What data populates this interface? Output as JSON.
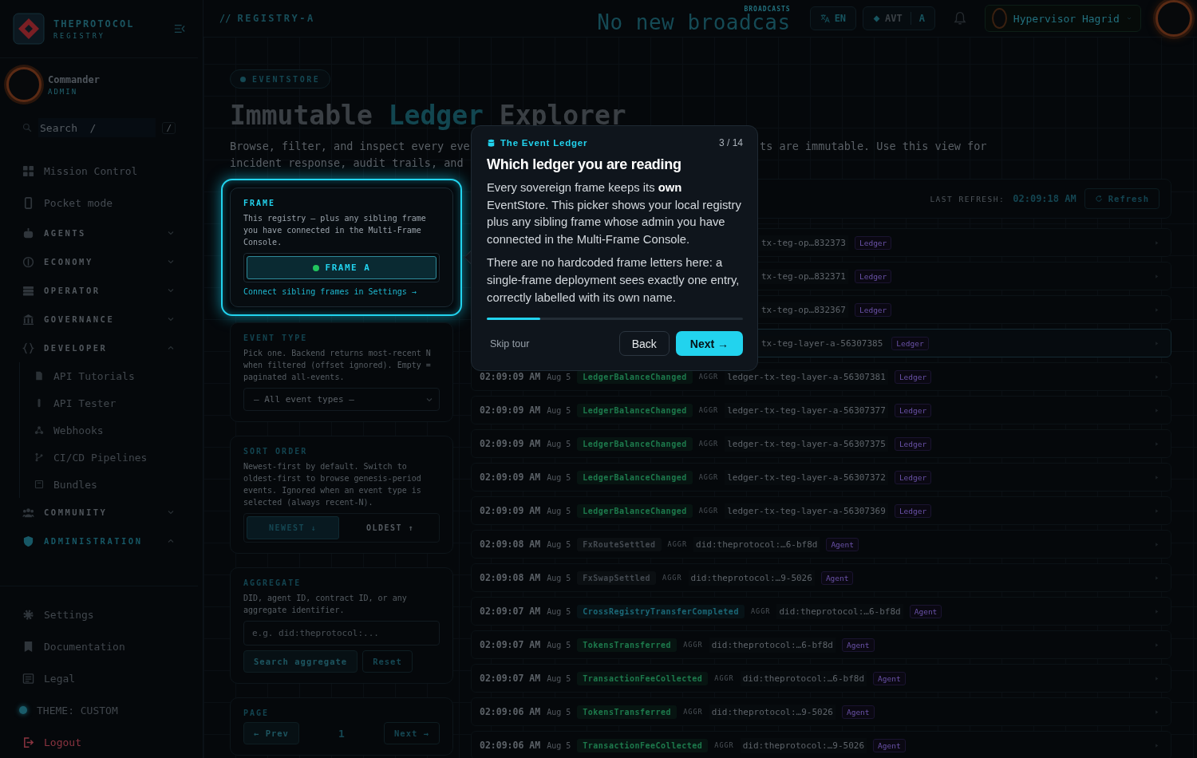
{
  "sidebar": {
    "brand": {
      "name": "THEPROTOCOL",
      "subtitle": "REGISTRY"
    },
    "user": {
      "name": "Commander",
      "role": "ADMIN"
    },
    "search": {
      "placeholder": "Search  /",
      "shortcut": "/"
    },
    "nav": [
      {
        "kind": "link",
        "label": "Mission Control",
        "selected": false
      },
      {
        "kind": "link",
        "label": "Pocket mode",
        "selected": false
      },
      {
        "kind": "section",
        "label": "AGENTS",
        "expanded": false,
        "selected": false
      },
      {
        "kind": "section",
        "label": "ECONOMY",
        "expanded": false,
        "selected": false
      },
      {
        "kind": "section",
        "label": "OPERATOR",
        "expanded": false,
        "selected": false
      },
      {
        "kind": "section",
        "label": "GOVERNANCE",
        "expanded": false,
        "selected": false
      },
      {
        "kind": "section",
        "label": "DEVELOPER",
        "expanded": true,
        "selected": false,
        "children": [
          {
            "label": "API Tutorials",
            "selected": false
          },
          {
            "label": "API Tester",
            "selected": false
          },
          {
            "label": "Webhooks",
            "selected": false
          },
          {
            "label": "CI/CD Pipelines",
            "selected": false
          },
          {
            "label": "Bundles",
            "selected": false
          }
        ]
      },
      {
        "kind": "section",
        "label": "COMMUNITY",
        "expanded": false,
        "selected": false
      },
      {
        "kind": "section",
        "label": "ADMINISTRATION",
        "expanded": true,
        "selected": true
      }
    ],
    "footer": [
      {
        "kind": "link",
        "label": "Settings"
      },
      {
        "kind": "link",
        "label": "Documentation"
      },
      {
        "kind": "link",
        "label": "Legal"
      },
      {
        "kind": "theme",
        "label": "THEME: CUSTOM"
      },
      {
        "kind": "danger",
        "label": "Logout"
      }
    ]
  },
  "topbar": {
    "separator": "//",
    "breadcrumb": "REGISTRY-A",
    "ticker_label": "BROADCASTS",
    "ticker": "No new broadcas",
    "language": "EN",
    "token": "AVT",
    "token_frame": "A",
    "user": "Hypervisor Hagrid"
  },
  "header": {
    "badge": "EVENTSTORE",
    "title_start": "Immutable",
    "title_highlight": "Ledger",
    "title_end": "Explorer",
    "description": [
      "Browse, filter, and inspect every eve",
      "ts are immutable. Use this view for",
      "incident response, audit trails, and"
    ]
  },
  "filters": {
    "frame": {
      "title": "FRAME",
      "description": "This registry — plus any sibling frame you have connected in the Multi-Frame Console.",
      "options": [
        {
          "label": "FRAME A",
          "selected": true
        }
      ],
      "link": "Connect sibling frames in Settings →"
    },
    "event_type": {
      "title": "EVENT TYPE",
      "description": "Pick one. Backend returns most-recent N when filtered (offset ignored). Empty = paginated all-events.",
      "value": "— All event types —"
    },
    "sort": {
      "title": "SORT ORDER",
      "description": "Newest-first by default. Switch to oldest-first to browse genesis-period events. Ignored when an event type is selected (always recent-N).",
      "options": [
        {
          "label": "NEWEST ↓",
          "selected": true
        },
        {
          "label": "OLDEST ↑",
          "selected": false
        }
      ]
    },
    "aggregate": {
      "title": "AGGREGATE",
      "description": "DID, agent ID, contract ID, or any aggregate identifier.",
      "placeholder": "e.g. did:theprotocol:...",
      "search": {
        "label": "Search aggregate",
        "disabled": true
      },
      "reset": "Reset"
    },
    "page": {
      "title": "PAGE",
      "prev": {
        "label": "← Prev",
        "disabled": true
      },
      "current": "1",
      "next": "Next →"
    }
  },
  "refresh": {
    "label": "LAST REFRESH:",
    "time": "02:09:18 AM",
    "button": "Refresh"
  },
  "events": [
    {
      "aggregate": "tx-teg-op…832373",
      "tag": "Ledger",
      "selected": false
    },
    {
      "aggregate": "tx-teg-op…832371",
      "tag": "Ledger",
      "selected": false
    },
    {
      "aggregate": "tx-teg-op…832367",
      "tag": "Ledger",
      "selected": false
    },
    {
      "aggregate": "tx-teg-layer-a-56307385",
      "tag": "Ledger",
      "selected": true
    },
    {
      "time": "02:09:09 AM",
      "date": "Aug 5",
      "type": "LedgerBalanceChanged",
      "color": "#1d7a4c",
      "aggr": "AGGR",
      "aggregate": "ledger-tx-teg-layer-a-56307381",
      "tag": "Ledger",
      "selected": false
    },
    {
      "time": "02:09:09 AM",
      "date": "Aug 5",
      "type": "LedgerBalanceChanged",
      "color": "#1d7a4c",
      "aggr": "AGGR",
      "aggregate": "ledger-tx-teg-layer-a-56307377",
      "tag": "Ledger",
      "selected": false
    },
    {
      "time": "02:09:09 AM",
      "date": "Aug 5",
      "type": "LedgerBalanceChanged",
      "color": "#1d7a4c",
      "aggr": "AGGR",
      "aggregate": "ledger-tx-teg-layer-a-56307375",
      "tag": "Ledger",
      "selected": false
    },
    {
      "time": "02:09:09 AM",
      "date": "Aug 5",
      "type": "LedgerBalanceChanged",
      "color": "#1d7a4c",
      "aggr": "AGGR",
      "aggregate": "ledger-tx-teg-layer-a-56307372",
      "tag": "Ledger",
      "selected": false
    },
    {
      "time": "02:09:09 AM",
      "date": "Aug 5",
      "type": "LedgerBalanceChanged",
      "color": "#1d7a4c",
      "aggr": "AGGR",
      "aggregate": "ledger-tx-teg-layer-a-56307369",
      "tag": "Ledger",
      "selected": false
    },
    {
      "time": "02:09:08 AM",
      "date": "Aug 5",
      "type": "FxRouteSettled",
      "color": "#434950",
      "aggr": "AGGR",
      "aggregate": "did:theprotocol:…6-bf8d",
      "tag": "Agent",
      "selected": false
    },
    {
      "time": "02:09:08 AM",
      "date": "Aug 5",
      "type": "FxSwapSettled",
      "color": "#434950",
      "aggr": "AGGR",
      "aggregate": "did:theprotocol:…9-5026",
      "tag": "Agent",
      "selected": false
    },
    {
      "time": "02:09:07 AM",
      "date": "Aug 5",
      "type": "CrossRegistryTransferCompleted",
      "color": "#1b6877",
      "aggr": "AGGR",
      "aggregate": "did:theprotocol:…6-bf8d",
      "tag": "Agent",
      "selected": false
    },
    {
      "time": "02:09:07 AM",
      "date": "Aug 5",
      "type": "TokensTransferred",
      "color": "#1d7a4c",
      "aggr": "AGGR",
      "aggregate": "did:theprotocol:…6-bf8d",
      "tag": "Agent",
      "selected": false
    },
    {
      "time": "02:09:07 AM",
      "date": "Aug 5",
      "type": "TransactionFeeCollected",
      "color": "#1d7a4c",
      "aggr": "AGGR",
      "aggregate": "did:theprotocol:…6-bf8d",
      "tag": "Agent",
      "selected": false
    },
    {
      "time": "02:09:06 AM",
      "date": "Aug 5",
      "type": "TokensTransferred",
      "color": "#1d7a4c",
      "aggr": "AGGR",
      "aggregate": "did:theprotocol:…9-5026",
      "tag": "Agent",
      "selected": false
    },
    {
      "time": "02:09:06 AM",
      "date": "Aug 5",
      "type": "TransactionFeeCollected",
      "color": "#1d7a4c",
      "aggr": "AGGR",
      "aggregate": "did:theprotocol:…9-5026",
      "tag": "Agent",
      "selected": false
    }
  ],
  "tour": {
    "section": "The Event Ledger",
    "step": "3 / 14",
    "title": "Which ledger you are reading",
    "paragraphs": [
      "Every sovereign frame keeps its **own** EventStore. This picker shows your local registry plus any sibling frame whose admin you have connected in the Multi-Frame Console.",
      "There are no hardcoded frame letters here: a single-frame deployment sees exactly one entry, correctly labelled with its own name."
    ],
    "level": 0.21,
    "skip": "Skip tour",
    "back": "Back",
    "next": "Next →"
  }
}
